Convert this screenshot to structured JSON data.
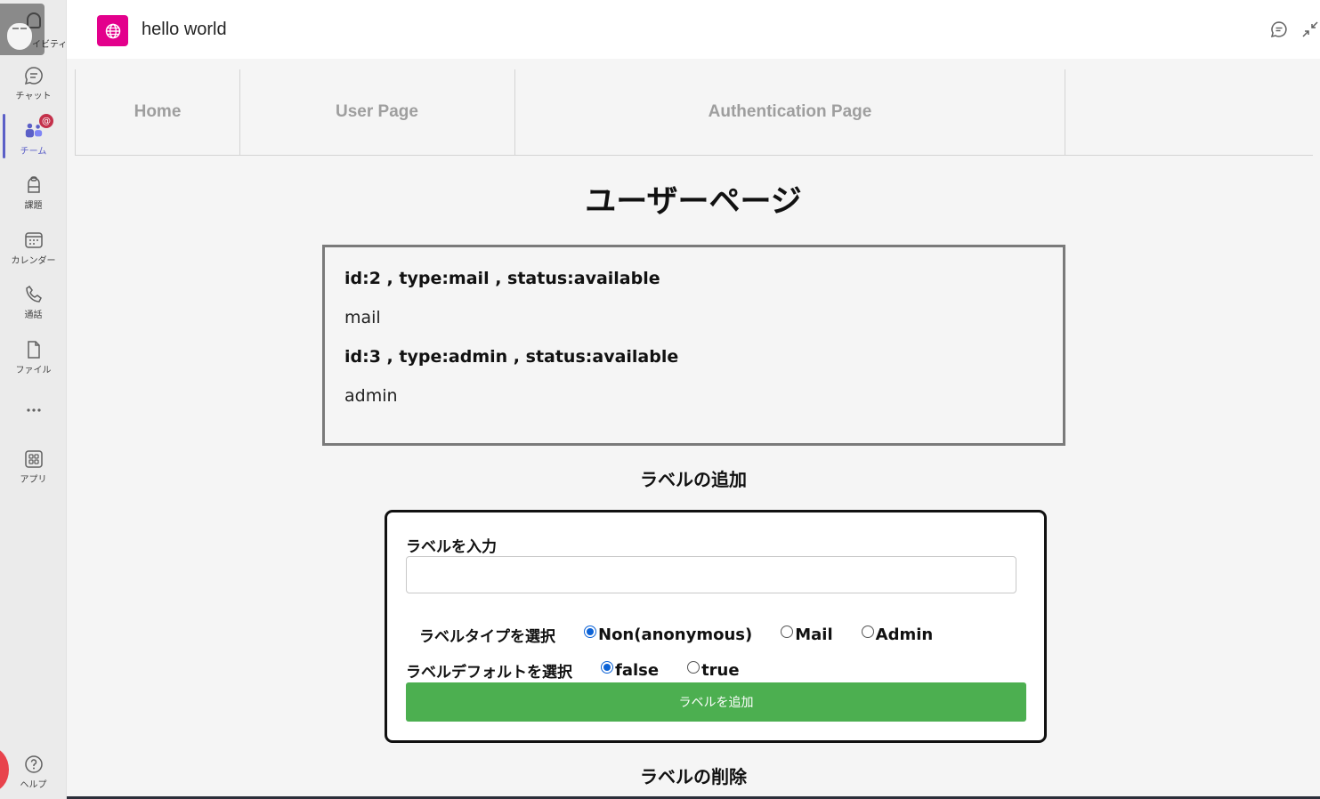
{
  "rail": {
    "activity_label": "イビティ",
    "items": [
      {
        "icon": "chat-icon",
        "label": "チャット"
      },
      {
        "icon": "teams-icon",
        "label": "チーム",
        "badge": "@"
      },
      {
        "icon": "assignments-icon",
        "label": "課題"
      },
      {
        "icon": "calendar-icon",
        "label": "カレンダー"
      },
      {
        "icon": "calls-icon",
        "label": "通話"
      },
      {
        "icon": "files-icon",
        "label": "ファイル"
      },
      {
        "icon": "more-icon",
        "label": "..."
      },
      {
        "icon": "apps-icon",
        "label": "アプリ"
      },
      {
        "icon": "help-icon",
        "label": "ヘルプ"
      }
    ]
  },
  "header": {
    "app_title": "hello world"
  },
  "nav": {
    "tabs": [
      {
        "label": "Home"
      },
      {
        "label": "User Page"
      },
      {
        "label": "Authentication Page"
      }
    ]
  },
  "page": {
    "title": "ユーザーページ"
  },
  "labels": [
    {
      "header": "id:2 , type:mail , status:available",
      "value": "mail"
    },
    {
      "header": "id:3 , type:admin , status:available",
      "value": "admin"
    }
  ],
  "add_section": {
    "title": "ラベルの追加",
    "input_label": "ラベルを入力",
    "input_value": "",
    "type_label": "ラベルタイプを選択",
    "type_options": [
      "Non(anonymous)",
      "Mail",
      "Admin"
    ],
    "type_selected": "Non(anonymous)",
    "default_label": "ラベルデフォルトを選択",
    "default_options": [
      "false",
      "true"
    ],
    "default_selected": "false",
    "submit_label": "ラベルを追加"
  },
  "delete_section": {
    "title": "ラベルの削除"
  },
  "colors": {
    "accent": "#5b5fc7",
    "app_logo": "#e3008c",
    "submit": "#4caf50",
    "badge": "#c4314b"
  }
}
